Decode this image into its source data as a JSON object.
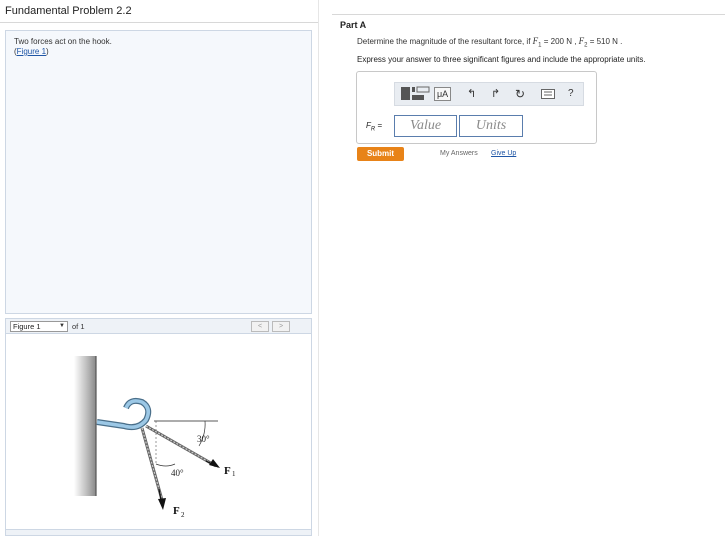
{
  "left": {
    "title": "Fundamental Problem 2.2",
    "problem_text": "Two forces act on the hook.",
    "figure_link_open": "(",
    "figure_link": "Figure 1",
    "figure_link_close": ")"
  },
  "figure_nav": {
    "selected": "Figure 1",
    "of_label": "of 1",
    "prev": "<",
    "next": ">"
  },
  "figure": {
    "angle_30": "30°",
    "angle_40": "40°",
    "f1_label": "F",
    "f1_sub": "1",
    "f2_label": "F",
    "f2_sub": "2"
  },
  "right": {
    "part_label": "Part A",
    "question_pre": "Determine the magnitude of the resultant force, if ",
    "f1_sym": "F",
    "f1_sub": "1",
    "f1_val": " = 200 N",
    "sep": " , ",
    "f2_sym": "F",
    "f2_sub": "2",
    "f2_val": " = 510 N",
    "question_end": " .",
    "instruction": "Express your answer to three significant figures and include the appropriate units.",
    "fr_label": "F",
    "fr_sub": "R",
    "fr_eq": " =",
    "value_placeholder": "Value",
    "units_placeholder": "Units",
    "toolbar": {
      "mu_label": "μA",
      "help": "?"
    },
    "submit": "Submit",
    "my_answers": "My Answers",
    "give_up": "Give Up"
  }
}
